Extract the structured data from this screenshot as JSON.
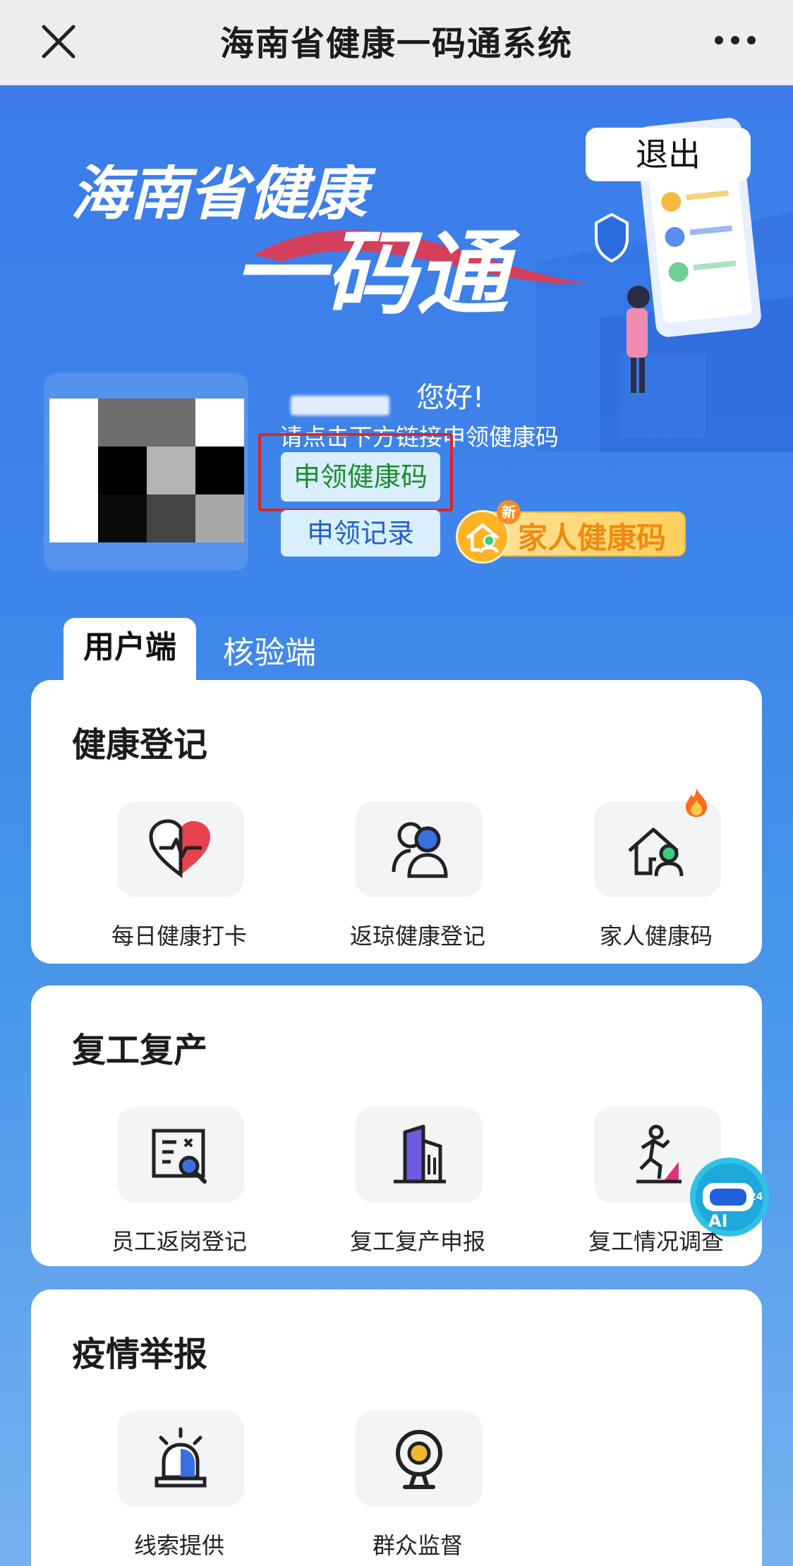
{
  "topbar": {
    "title": "海南省健康一码通系统",
    "close_icon": "close-icon",
    "more_icon": "more-dots-icon"
  },
  "banner": {
    "line1": "海南省健康",
    "line2": "一码通",
    "logout_label": "退出"
  },
  "user": {
    "greeting": "您好!",
    "hint": "请点击下方链接申领健康码",
    "apply_button": "申领健康码",
    "record_button": "申领记录",
    "family_badge_label": "家人健康码",
    "family_badge_new": "新"
  },
  "tabs": {
    "active": "用户端",
    "inactive": "核验端"
  },
  "sections": {
    "health": {
      "title": "健康登记",
      "items": [
        {
          "label": "每日健康打卡",
          "icon": "heart-pulse-icon"
        },
        {
          "label": "返琼健康登记",
          "icon": "users-icon"
        },
        {
          "label": "家人健康码",
          "icon": "home-person-icon"
        }
      ]
    },
    "work": {
      "title": "复工复产",
      "items": [
        {
          "label": "员工返岗登记",
          "icon": "id-card-search-icon"
        },
        {
          "label": "复工复产申报",
          "icon": "building-icon"
        },
        {
          "label": "复工情况调查",
          "icon": "climbing-person-icon"
        }
      ]
    },
    "report": {
      "title": "疫情举报",
      "items": [
        {
          "label": "线索提供",
          "icon": "alarm-light-icon"
        },
        {
          "label": "群众监督",
          "icon": "camera-icon"
        }
      ]
    }
  },
  "ai_assistant": {
    "text": "AI",
    "badge": "24"
  },
  "colors": {
    "blue": "#3f86ea",
    "green_text": "#1d8c2a",
    "blue_text": "#2460c8",
    "orange": "#f08a10",
    "highlight_red": "#e02424"
  }
}
